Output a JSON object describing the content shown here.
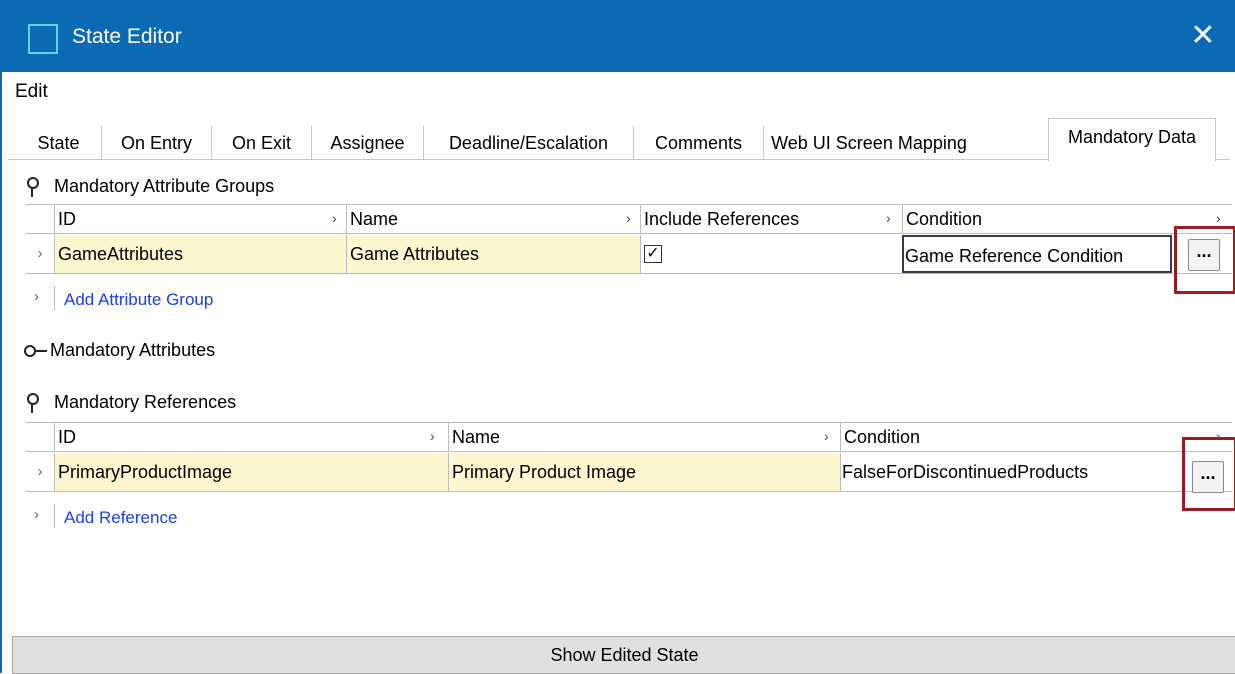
{
  "window": {
    "title": "State Editor",
    "close_glyph": "✕"
  },
  "menu": {
    "items": [
      "Edit"
    ]
  },
  "tabs": [
    {
      "label": "State"
    },
    {
      "label": "On Entry"
    },
    {
      "label": "On Exit"
    },
    {
      "label": "Assignee"
    },
    {
      "label": "Deadline/Escalation"
    },
    {
      "label": "Comments"
    },
    {
      "label": "Web UI Screen Mapping"
    },
    {
      "label": "Mandatory Data",
      "active": true
    }
  ],
  "attribute_groups": {
    "label": "Mandatory Attribute Groups",
    "columns": [
      "ID",
      "Name",
      "Include References",
      "Condition"
    ],
    "rows": [
      {
        "id": "GameAttributes",
        "name": "Game Attributes",
        "include_references": true,
        "condition": "Game Reference Condition"
      }
    ],
    "add_label": "Add Attribute Group",
    "browse_label": "..."
  },
  "attributes": {
    "label": "Mandatory Attributes"
  },
  "references": {
    "label": "Mandatory References",
    "columns": [
      "ID",
      "Name",
      "Condition"
    ],
    "rows": [
      {
        "id": "PrimaryProductImage",
        "name": "Primary Product Image",
        "condition": "FalseForDiscontinuedProducts"
      }
    ],
    "add_label": "Add Reference",
    "browse_label": "..."
  },
  "footer": {
    "button_label": "Show Edited State"
  },
  "colors": {
    "titlebar": "#0a6ab4",
    "highlight": "#9e1b22",
    "cell_highlight": "#fdf7cf",
    "link": "#1a3ef0"
  },
  "icons": [
    "app-window-icon",
    "close-icon",
    "pin-icon",
    "key-icon",
    "row-expander-icon",
    "column-sort-icon"
  ]
}
